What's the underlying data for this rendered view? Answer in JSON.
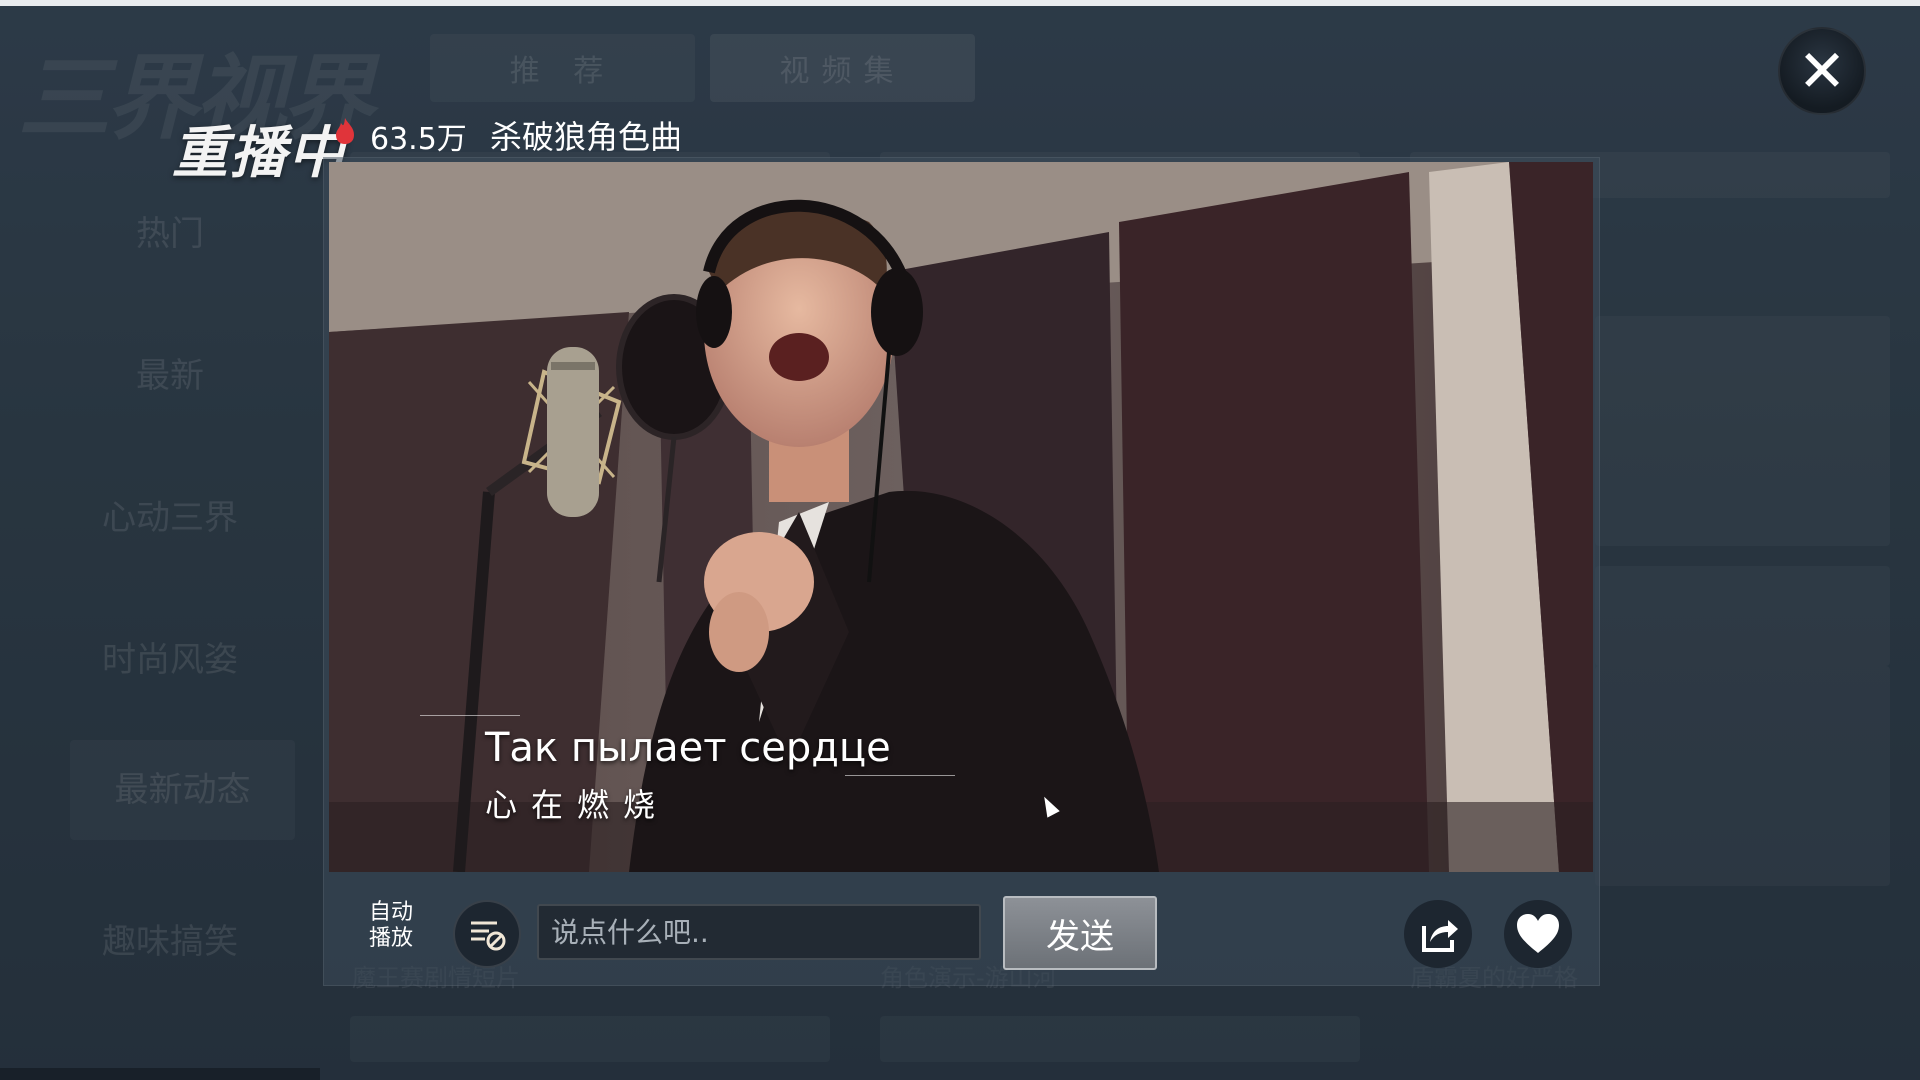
{
  "app": {
    "logo_text": "三界视界"
  },
  "background": {
    "tabs": [
      {
        "label": "推 荐"
      },
      {
        "label": "视频集"
      }
    ],
    "sidebar": [
      {
        "label": "热门"
      },
      {
        "label": "最新"
      },
      {
        "label": "心动三界"
      },
      {
        "label": "时尚风姿"
      },
      {
        "label": "最新动态"
      },
      {
        "label": "趣味搞笑"
      }
    ],
    "captions": [
      "魔王赛剧情短片",
      "角色演示-游山河",
      "盾霸夏的好严格"
    ]
  },
  "player": {
    "status_label": "重播中",
    "views": "63.5万",
    "title": "杀破狼角色曲",
    "subtitle_ru": "Так пылает сердце",
    "subtitle_zh": "心在燃烧"
  },
  "controls": {
    "autoplay_label_line1": "自动",
    "autoplay_label_line2": "播放",
    "comment_placeholder": "说点什么吧..",
    "send_label": "发送"
  },
  "colors": {
    "background": "#2f3d4c",
    "button": "#7a7f85",
    "hot_icon": "#e0343a"
  },
  "icons": {
    "close": "close-icon",
    "autoplay": "autoplay-icon",
    "share": "share-icon",
    "like": "heart-icon",
    "hot": "flame-icon"
  }
}
